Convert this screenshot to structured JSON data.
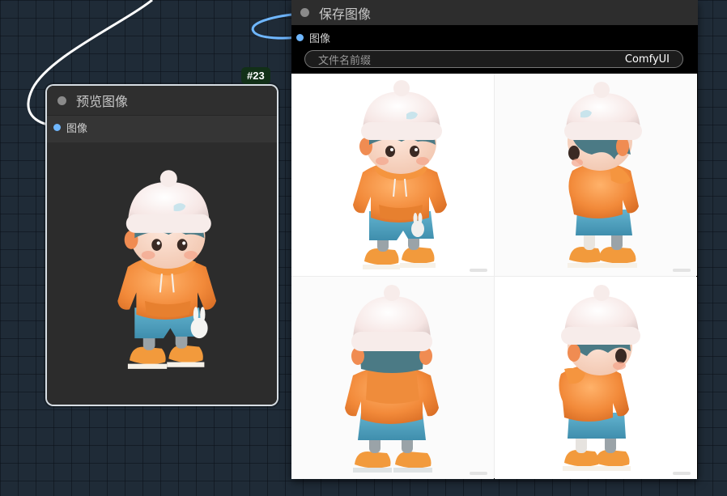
{
  "preview_node": {
    "title": "预览图像",
    "badge": "#23",
    "input_label": "图像"
  },
  "save_node": {
    "title": "保存图像",
    "input_label": "图像",
    "widget": {
      "label": "文件名前缀",
      "value": "ComfyUI"
    },
    "images": [
      {
        "view": "front-three-quarter"
      },
      {
        "view": "side"
      },
      {
        "view": "back"
      },
      {
        "view": "side-three-quarter"
      }
    ]
  },
  "colors": {
    "socket": "#6fb7ff",
    "badge_bg": "#123018",
    "canvas_bg": "#1f2b37",
    "jacket": "#f08a3a",
    "shorts": "#4fa3c2",
    "hair": "#4b7a85",
    "hat": "#f6e8e6"
  },
  "icons": {
    "collapse": "circle-icon",
    "socket": "socket-dot-icon"
  }
}
